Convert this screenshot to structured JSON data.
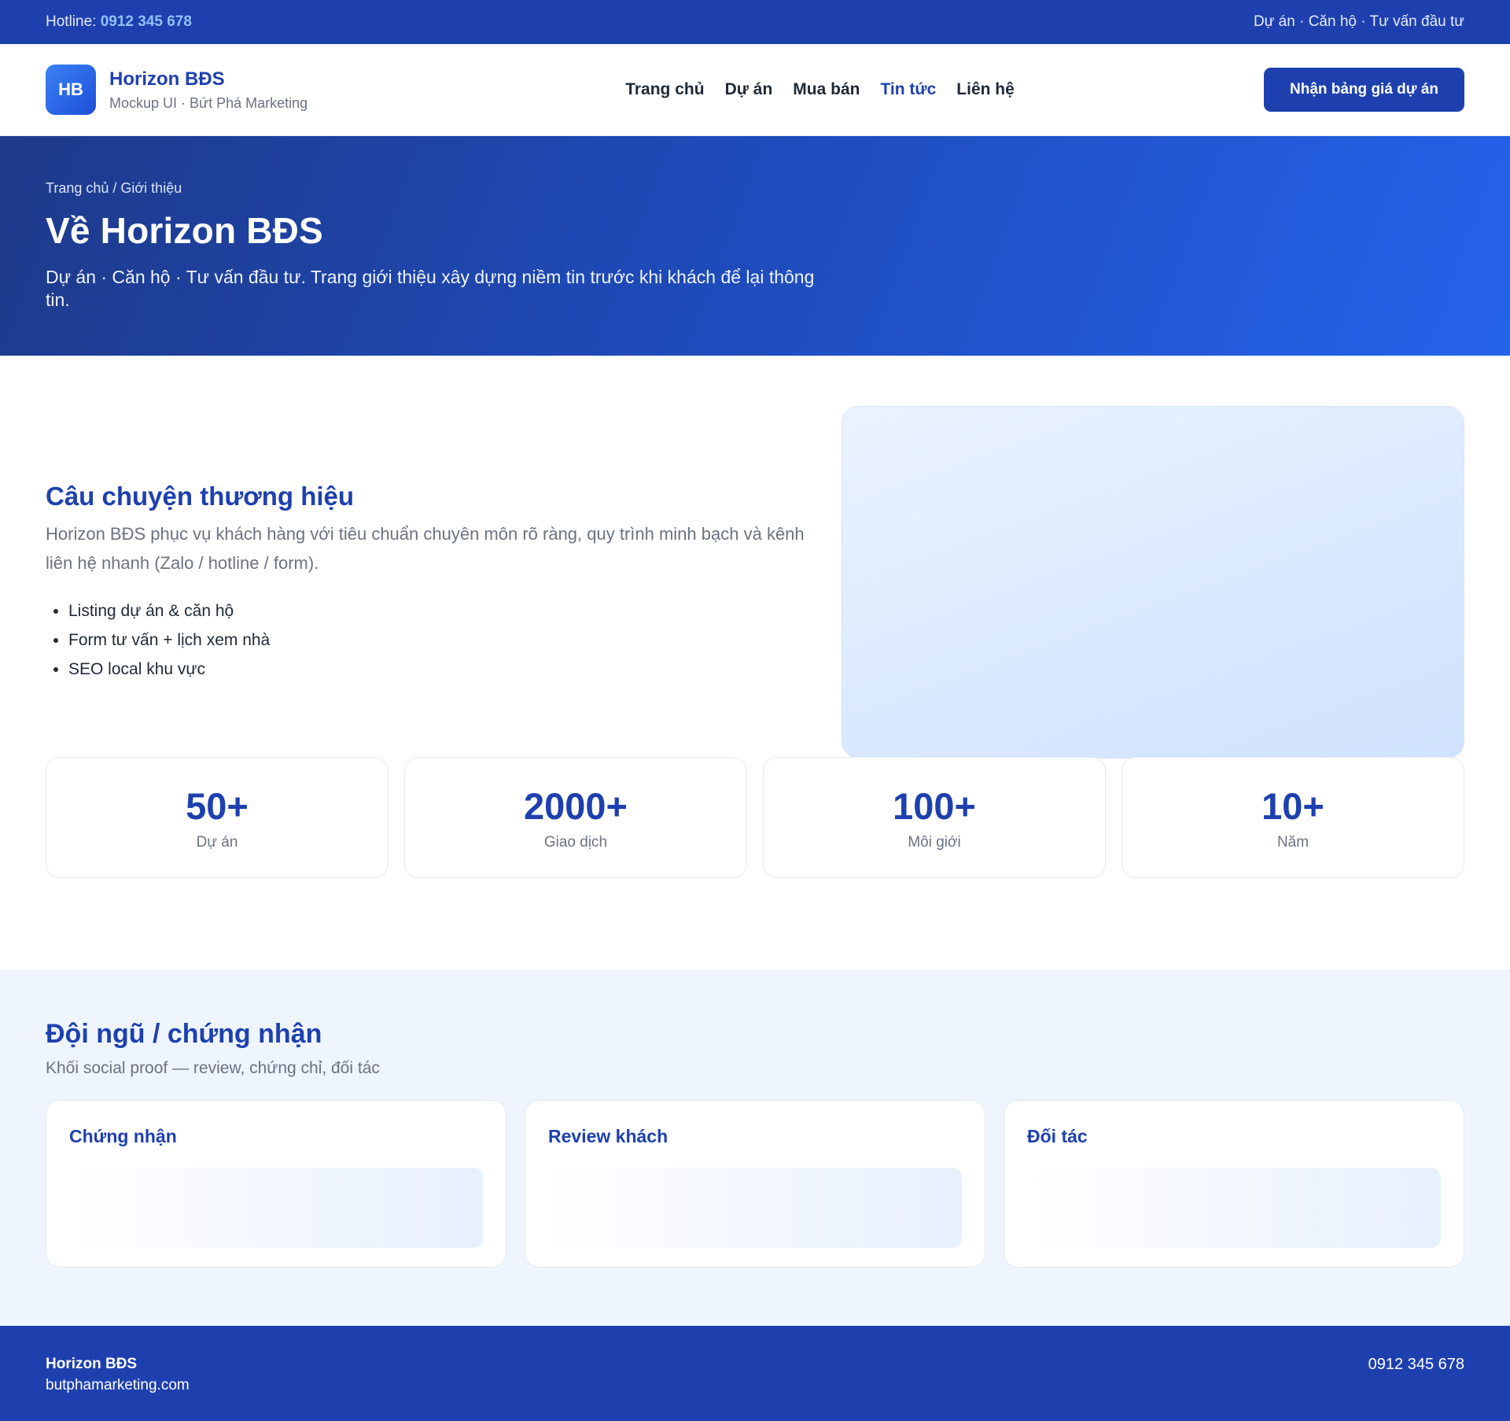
{
  "topbar": {
    "hotline_label": "Hotline:",
    "hotline_number": "0912 345 678",
    "tagline": "Dự án · Căn hộ · Tư vấn đầu tư"
  },
  "header": {
    "logo_initials": "HB",
    "brand_name": "Horizon BĐS",
    "brand_sub": "Mockup UI · Bứt Phá Marketing",
    "nav": [
      {
        "label": "Trang chủ",
        "active": false
      },
      {
        "label": "Dự án",
        "active": false
      },
      {
        "label": "Mua bán",
        "active": false
      },
      {
        "label": "Tin tức",
        "active": true
      },
      {
        "label": "Liên hệ",
        "active": false
      }
    ],
    "cta_label": "Nhận bảng giá dự án"
  },
  "hero": {
    "breadcrumb": "Trang chủ / Giới thiệu",
    "title": "Về Horizon BĐS",
    "description": "Dự án · Căn hộ · Tư vấn đầu tư. Trang giới thiệu xây dựng niềm tin trước khi khách để lại thông tin."
  },
  "story": {
    "title": "Câu chuyện thương hiệu",
    "description": "Horizon BĐS phục vụ khách hàng với tiêu chuẩn chuyên môn rõ ràng, quy trình minh bạch và kênh liên hệ nhanh (Zalo / hotline / form).",
    "bullets": [
      "Listing dự án & căn hộ",
      "Form tư vấn + lịch xem nhà",
      "SEO local khu vực"
    ]
  },
  "stats": [
    {
      "value": "50+",
      "label": "Dự án"
    },
    {
      "value": "2000+",
      "label": "Giao dịch"
    },
    {
      "value": "100+",
      "label": "Môi giới"
    },
    {
      "value": "10+",
      "label": "Năm"
    }
  ],
  "team": {
    "title": "Đội ngũ / chứng nhận",
    "subtitle": "Khối social proof — review, chứng chỉ, đối tác",
    "cards": [
      {
        "title": "Chứng nhận"
      },
      {
        "title": "Review khách"
      },
      {
        "title": "Đối tác"
      }
    ]
  },
  "footer": {
    "brand": "Horizon BĐS",
    "website": "butphamarketing.com",
    "phone": "0912 345 678"
  },
  "colors": {
    "primary": "#1e40af",
    "accent": "#2563eb",
    "hotline": "#8fc2ff",
    "section_bg": "#eef5fe"
  }
}
